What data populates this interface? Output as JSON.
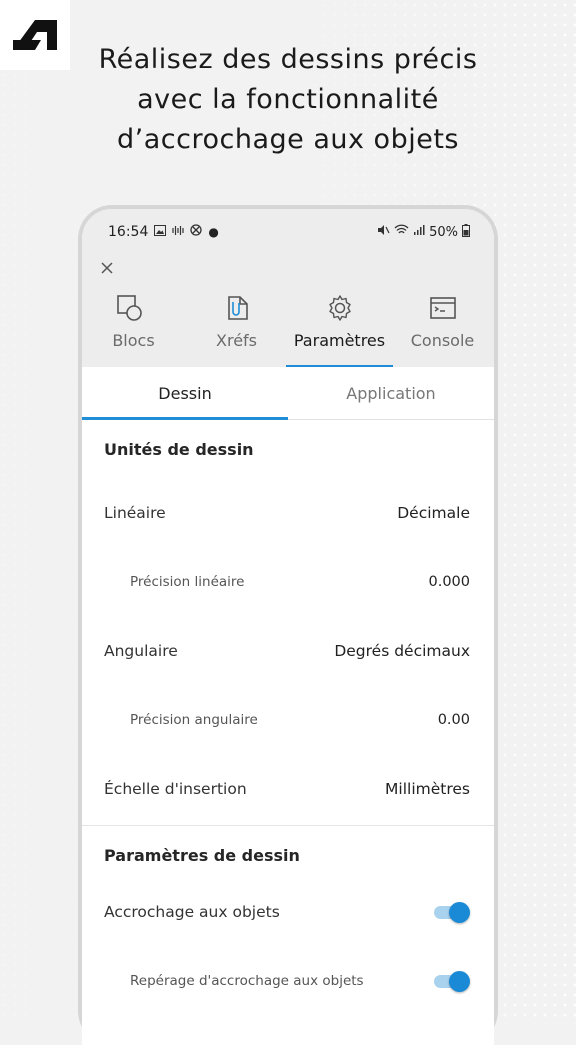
{
  "headline": {
    "line1": "Réalisez des dessins précis",
    "line2": "avec la fonctionnalité",
    "line3": "d’accrochage aux objets"
  },
  "status_bar": {
    "time": "16:54",
    "battery": "50%"
  },
  "tabs": [
    {
      "label": "Blocs",
      "icon": "blocks-icon"
    },
    {
      "label": "Xréfs",
      "icon": "xref-icon"
    },
    {
      "label": "Paramètres",
      "icon": "gear-icon",
      "active": true
    },
    {
      "label": "Console",
      "icon": "console-icon"
    }
  ],
  "subtabs": [
    {
      "label": "Dessin",
      "active": true
    },
    {
      "label": "Application"
    }
  ],
  "units_section": {
    "title": "Unités de dessin",
    "rows": [
      {
        "label": "Linéaire",
        "value": "Décimale"
      },
      {
        "label": "Précision linéaire",
        "value": "0.000"
      },
      {
        "label": "Angulaire",
        "value": "Degrés décimaux"
      },
      {
        "label": "Précision angulaire",
        "value": "0.00"
      },
      {
        "label": "Échelle d'insertion",
        "value": "Millimètres"
      }
    ]
  },
  "drawing_section": {
    "title": "Paramètres de dessin",
    "rows": [
      {
        "label": "Accrochage aux objets",
        "enabled": true
      },
      {
        "label": "Repérage d'accrochage aux objets",
        "enabled": true
      }
    ]
  },
  "colors": {
    "accent": "#1f8ed6",
    "toggle_knob": "#1a8ad6",
    "toggle_track": "#a9d2ee"
  }
}
